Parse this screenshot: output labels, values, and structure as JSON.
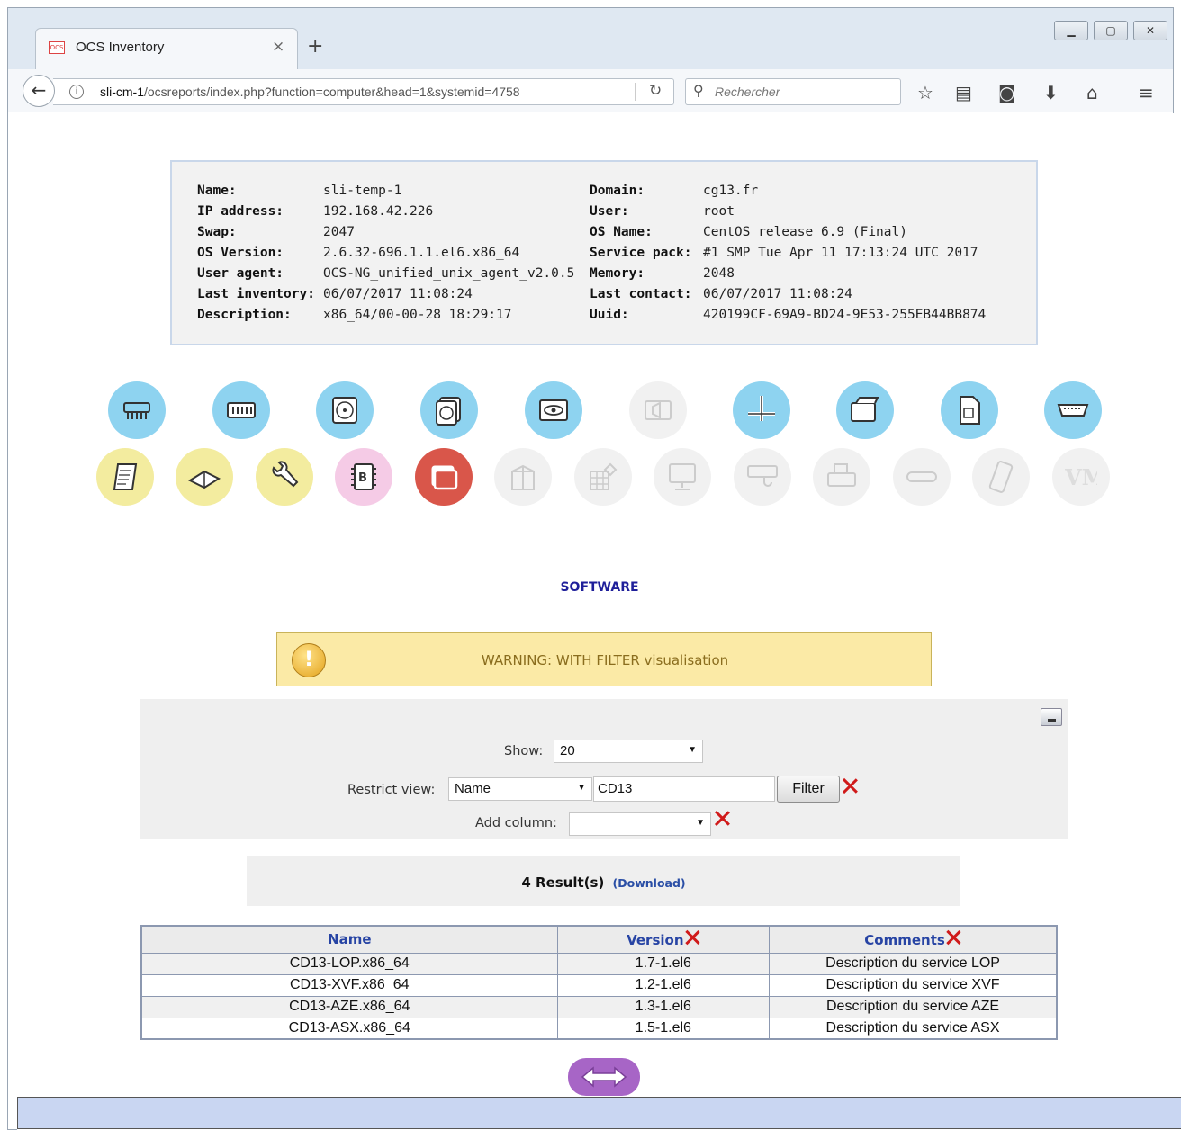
{
  "browser": {
    "tab_title": "OCS Inventory",
    "favicon_text": "OCS",
    "new_tab": "+",
    "tab_close": "×",
    "url_host": "sli-cm-1",
    "url_path": "/ocsreports/index.php?function=computer&head=1&systemid=4758",
    "search_placeholder": "Rechercher"
  },
  "summary": {
    "left": [
      {
        "label": "Name:",
        "value": "sli-temp-1"
      },
      {
        "label": "IP address:",
        "value": "192.168.42.226"
      },
      {
        "label": "Swap:",
        "value": "2047"
      },
      {
        "label": "OS Version:",
        "value": "2.6.32-696.1.1.el6.x86_64"
      },
      {
        "label": "User agent:",
        "value": "OCS-NG_unified_unix_agent_v2.0.5"
      },
      {
        "label": "Last inventory:",
        "value": "06/07/2017 11:08:24"
      },
      {
        "label": "Description:",
        "value": "x86_64/00-00-28 18:29:17"
      }
    ],
    "right": [
      {
        "label": "Domain:",
        "value": "cg13.fr"
      },
      {
        "label": "User:",
        "value": "root"
      },
      {
        "label": "OS Name:",
        "value": "CentOS release 6.9 (Final)"
      },
      {
        "label": "Service pack:",
        "value": "#1 SMP Tue Apr 11 17:13:24 UTC 2017"
      },
      {
        "label": "Memory:",
        "value": "2048"
      },
      {
        "label": "Last contact:",
        "value": "06/07/2017 11:08:24"
      },
      {
        "label": "Uuid:",
        "value": "420199CF-69A9-BD24-9E53-255EB44BB874"
      }
    ]
  },
  "categories_row1": [
    "processor-icon",
    "memory-icon",
    "storage-icon",
    "drives-icon",
    "video-icon",
    "sound-icon",
    "network-icon",
    "controllers-icon",
    "slots-icon",
    "ports-icon"
  ],
  "categories_row2": [
    "registry-icon",
    "administrative-info-icon",
    "configuration-icon",
    "bios-icon",
    "software-icon",
    "packages-icon",
    "groups-icon",
    "monitors-icon",
    "input-devices-icon",
    "printers-icon",
    "modems-icon",
    "phones-icon",
    "virtual-machines-icon"
  ],
  "vm_text": "VM",
  "bios_text": "B",
  "section_title": "SOFTWARE",
  "warning": {
    "text": "WARNING: WITH FILTER visualisation",
    "icon": "!"
  },
  "filters": {
    "show_label": "Show:",
    "show_value": "20",
    "restrict_label": "Restrict view:",
    "restrict_field": "Name",
    "restrict_value": "CD13",
    "filter_button": "Filter",
    "add_column_label": "Add column:",
    "add_column_value": ""
  },
  "results": {
    "count": "4 Result(s)",
    "download": "(Download)"
  },
  "table": {
    "headers": [
      "Name",
      "Version",
      "Comments"
    ],
    "rows": [
      [
        "CD13-LOP.x86_64",
        "1.7-1.el6",
        "Description du service LOP"
      ],
      [
        "CD13-XVF.x86_64",
        "1.2-1.el6",
        "Description du service XVF"
      ],
      [
        "CD13-AZE.x86_64",
        "1.3-1.el6",
        "Description du service AZE"
      ],
      [
        "CD13-ASX.x86_64",
        "1.5-1.el6",
        "Description du service ASX"
      ]
    ]
  },
  "colors": {
    "accent": "#1f1f9a",
    "header_text": "#2744a4",
    "warning_bg": "#fbeaa6",
    "active_icon": "#d9564a"
  }
}
